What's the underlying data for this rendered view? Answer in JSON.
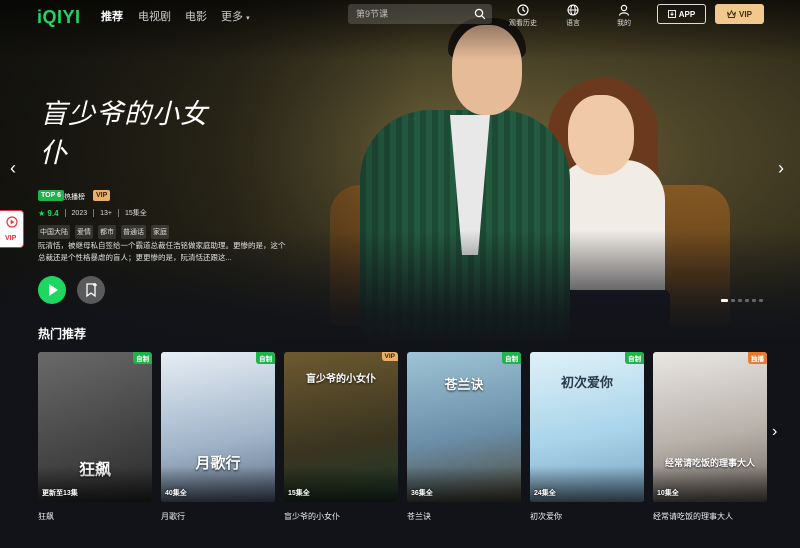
{
  "nav": {
    "logo": "iQIYI",
    "items": [
      "推荐",
      "电视剧",
      "电影",
      "更多"
    ],
    "search_placeholder": "第9节课",
    "tools": [
      "观看历史",
      "语言",
      "我的"
    ],
    "app_label": "APP",
    "vip_label": "VIP"
  },
  "hero": {
    "title_art": "盲少爷的小女仆",
    "badge_top": "TOP 6",
    "badge_top_label": "热播榜",
    "badge_vip": "VIP",
    "score": "9.4",
    "year": "2023",
    "age": "13+",
    "episodes": "15集全",
    "tags": [
      "中国大陆",
      "爱情",
      "都市",
      "普通话",
      "家庭"
    ],
    "description": "阮清恬，被继母私自签给一个霸道总裁任浩铭做家庭助理。更惨的是，这个总裁还是个性格暴虐的盲人；更更惨的是，阮清恬还跟这...",
    "side_vip": "VIP",
    "slide_count": 6,
    "active_slide": 1
  },
  "section": {
    "title": "热门推荐",
    "cards": [
      {
        "name": "狂飙",
        "ep": "更新至13集",
        "badge": "自制",
        "badge_type": "bz",
        "poster_title": "狂飙",
        "bg": "linear-gradient(160deg,#6a6a6a,#2b2b2b)"
      },
      {
        "name": "月歌行",
        "ep": "40集全",
        "badge": "自制",
        "badge_type": "bz",
        "poster_title": "月歌行",
        "bg": "linear-gradient(170deg,#e7eef5,#9fb3c8 60%,#5e6f86)"
      },
      {
        "name": "盲少爷的小女仆",
        "ep": "15集全",
        "badge": "VIP",
        "badge_type": "bv",
        "poster_title": "盲少爷的小女仆",
        "bg": "linear-gradient(170deg,#6d5a30,#3a3420 60%,#1f3a2a)"
      },
      {
        "name": "苍兰诀",
        "ep": "36集全",
        "badge": "自制",
        "badge_type": "bz",
        "poster_title": "苍兰诀",
        "bg": "linear-gradient(170deg,#9ec4d6,#6b8fa8 55%,#4f4a3a)"
      },
      {
        "name": "初次爱你",
        "ep": "24集全",
        "badge": "自制",
        "badge_type": "bz",
        "poster_title": "初次爱你",
        "bg": "linear-gradient(170deg,#dff1f8,#a9d4ea 55%,#7aa3c0)"
      },
      {
        "name": "经常请吃饭的理事大人",
        "ep": "10集全",
        "badge": "独播",
        "badge_type": "bd",
        "poster_title": "经常请吃饭的理事大人",
        "bg": "linear-gradient(170deg,#e9e6e3,#b9b2ab 55%,#6e6660)"
      }
    ]
  },
  "colors": {
    "brand": "#1ed760",
    "vip_gold": "#f2c98d",
    "page_bg": "#111319"
  }
}
